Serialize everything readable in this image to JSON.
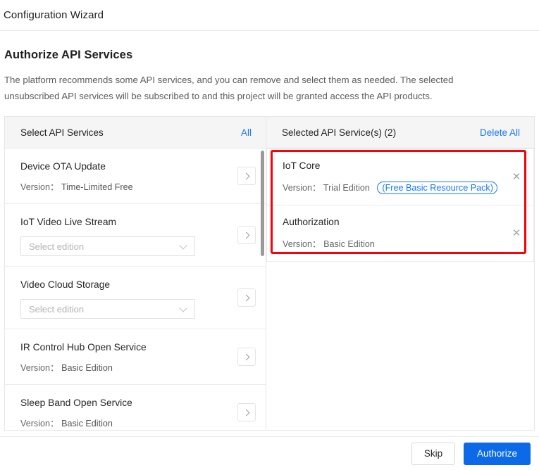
{
  "window": {
    "title": "Configuration Wizard"
  },
  "page": {
    "heading": "Authorize API Services",
    "description": "The platform recommends some API services, and you can remove and select them as needed. The selected unsubscribed API services will be subscribed to and this project will be granted access the API products."
  },
  "colors": {
    "accent_blue": "#1677ff",
    "primary_button": "#0c6ae8",
    "highlight_red": "#fb0007",
    "panel_header_bg": "#f5f5f5",
    "border": "#e6e6e6"
  },
  "available_panel": {
    "header_title": "Select API Services",
    "header_action": "All",
    "version_label": "Version：",
    "edition_placeholder": "Select edition",
    "items": [
      {
        "name": "Device OTA Update",
        "has_select": false,
        "version": "Time-Limited Free"
      },
      {
        "name": "IoT Video Live Stream",
        "has_select": true,
        "version": ""
      },
      {
        "name": "Video Cloud Storage",
        "has_select": true,
        "version": ""
      },
      {
        "name": "IR Control Hub Open Service",
        "has_select": false,
        "version": "Basic Edition"
      },
      {
        "name": "Sleep Band Open Service",
        "has_select": false,
        "version": "Basic Edition"
      }
    ]
  },
  "selected_panel": {
    "header_title": "Selected API Service(s) (2)",
    "header_action": "Delete All",
    "version_label": "Version：",
    "items": [
      {
        "name": "IoT Core",
        "version": "Trial Edition",
        "resource_pack": "(Free Basic Resource Pack)"
      },
      {
        "name": "Authorization",
        "version": "Basic Edition",
        "resource_pack": ""
      }
    ]
  },
  "footer": {
    "skip_label": "Skip",
    "authorize_label": "Authorize"
  }
}
